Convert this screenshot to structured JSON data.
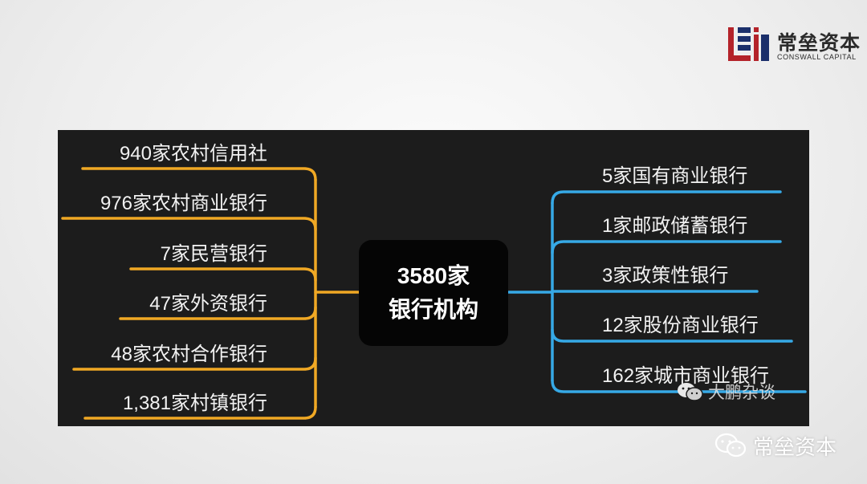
{
  "logo": {
    "name_cn": "常垒资本",
    "name_en": "CONSWALL CAPITAL",
    "colors": {
      "red": "#b4232a",
      "navy": "#1b2f6b"
    }
  },
  "diagram": {
    "center": {
      "line1": "3580家",
      "line2": "银行机构"
    },
    "left_branches": [
      "940家农村信用社",
      "976家农村商业银行",
      "7家民营银行",
      "47家外资银行",
      "48家农村合作银行",
      "1,381家村镇银行"
    ],
    "right_branches": [
      "5家国有商业银行",
      "1家邮政储蓄银行",
      "3家政策性银行",
      "12家股份商业银行",
      "162家城市商业银行"
    ],
    "colors": {
      "left": "#f0a824",
      "right": "#36a9e6",
      "panel": "#1c1c1c"
    }
  },
  "watermarks": {
    "inner": "大鹏杂谈",
    "outer": "常垒资本"
  }
}
